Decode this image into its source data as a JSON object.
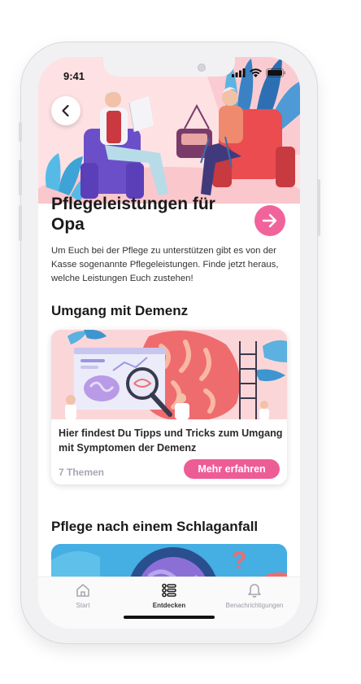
{
  "status_bar": {
    "time": "9:41"
  },
  "hero": {
    "title": "Pflegeleistungen für Opa"
  },
  "intro_text": "Um Euch bei der Pflege zu unterstützen gibt es von der Kasse sogenannte Pflegeleistungen. Finde jetzt heraus, welche Leistungen Euch zustehen!",
  "sections": [
    {
      "title": "Umgang mit Demenz",
      "card": {
        "text": "Hier findest Du Tipps und Tricks zum Umgang mit Symptomen der Demenz",
        "count": "7 Themen",
        "button": "Mehr erfahren"
      }
    },
    {
      "title": "Pflege nach einem Schlaganfall"
    }
  ],
  "tabs": [
    {
      "label": "Start",
      "icon": "home-icon",
      "active": false
    },
    {
      "label": "Entdecken",
      "icon": "list-icon",
      "active": true
    },
    {
      "label": "Benachrichtigungen",
      "icon": "bell-icon",
      "active": false
    }
  ],
  "colors": {
    "accent": "#ee5c95",
    "hero_bg": "#fde1e3"
  }
}
